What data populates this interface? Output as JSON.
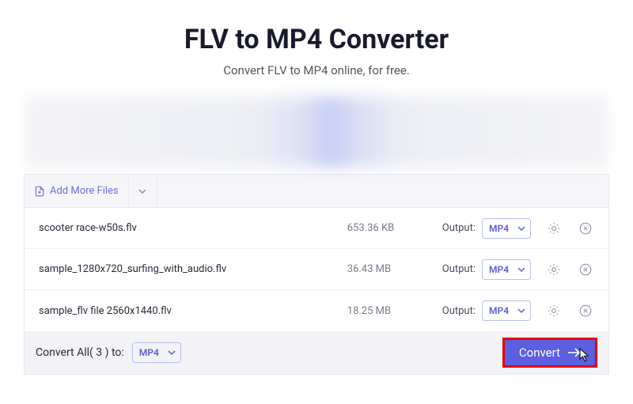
{
  "header": {
    "title": "FLV to MP4 Converter",
    "subtitle": "Convert FLV to MP4 online, for free."
  },
  "toolbar": {
    "add_files_label": "Add More Files"
  },
  "output_label": "Output:",
  "files": [
    {
      "name": "scooter race-w50s.flv",
      "size": "653.36 KB",
      "format": "MP4"
    },
    {
      "name": "sample_1280x720_surfing_with_audio.flv",
      "size": "36.43 MB",
      "format": "MP4"
    },
    {
      "name": "sample_flv file 2560x1440.flv",
      "size": "18.25 MB",
      "format": "MP4"
    }
  ],
  "footer": {
    "label": "Convert All( 3 ) to:",
    "format": "MP4",
    "convert_label": "Convert"
  }
}
